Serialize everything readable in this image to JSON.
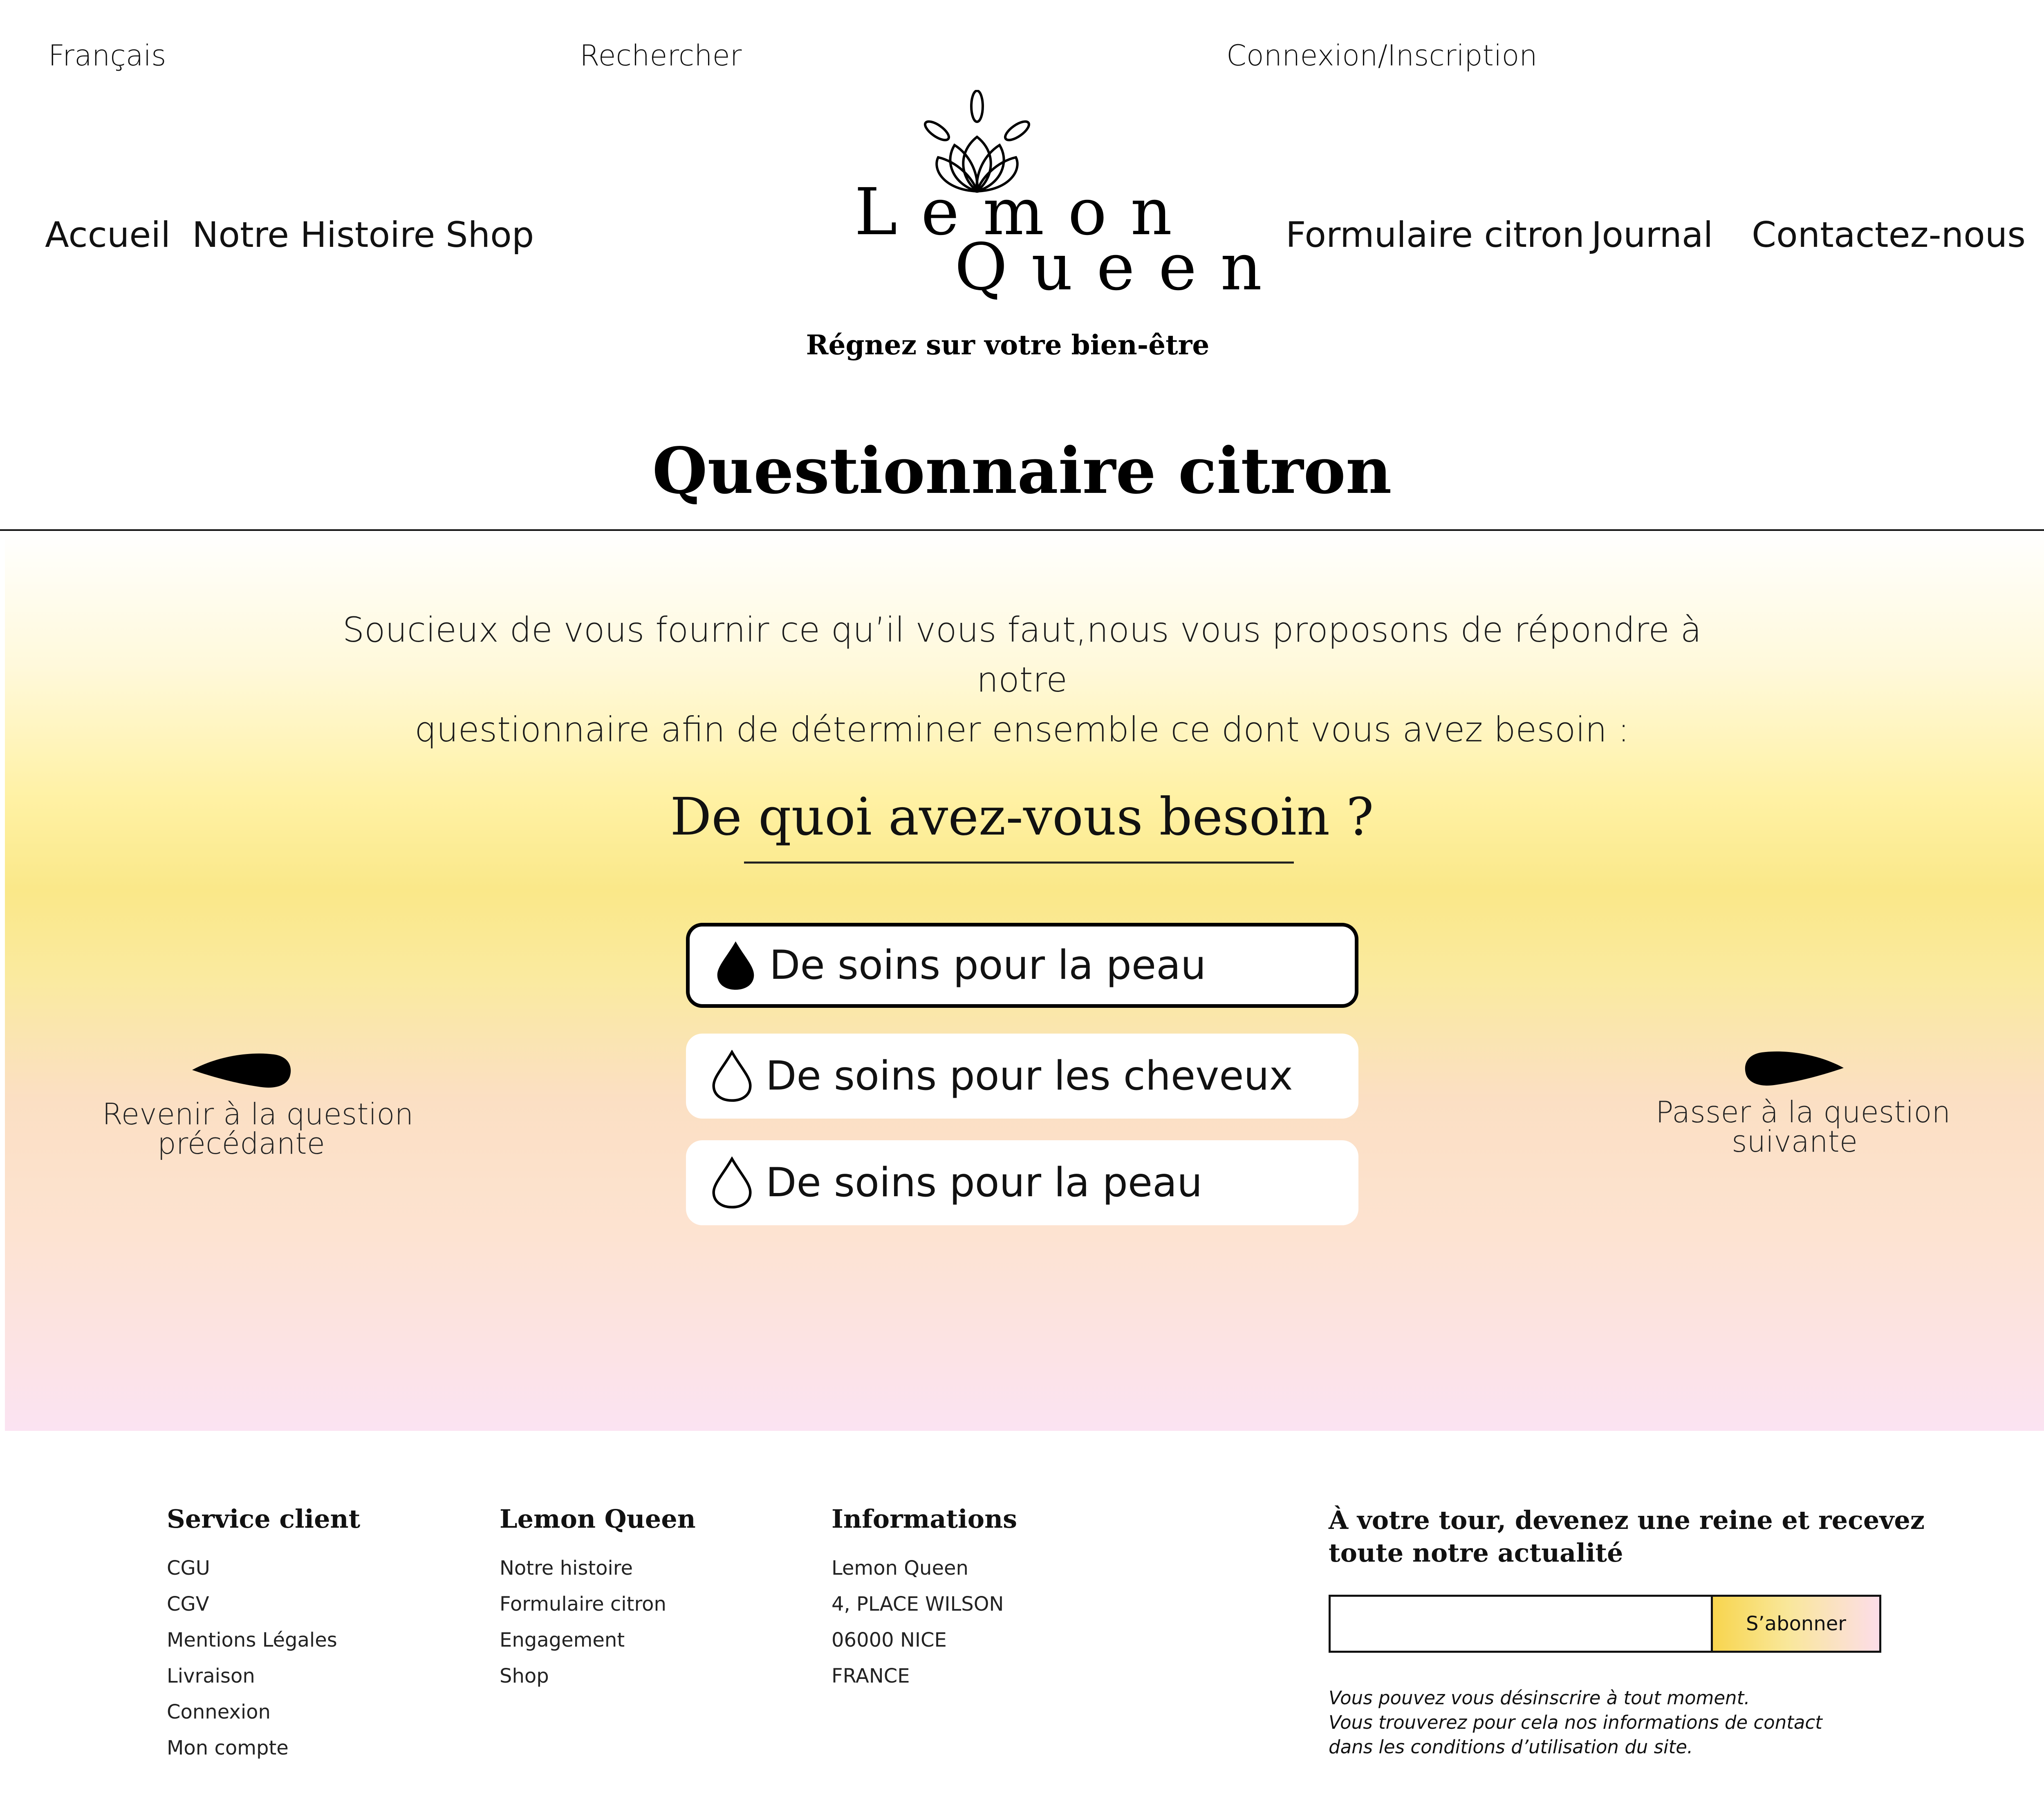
{
  "header": {
    "language": "Français",
    "search": "Rechercher",
    "account": "Connexion/Inscription",
    "nav_left": [
      "Accueil",
      "Notre Histoire",
      "Shop"
    ],
    "nav_right": [
      "Formulaire citron",
      "Journal",
      "Contactez-nous"
    ],
    "logo": {
      "line1": "Lemon",
      "line2": "Queen",
      "tagline": "Régnez sur votre bien-être"
    }
  },
  "page": {
    "title": "Questionnaire citron",
    "intro_line1": "Soucieux de vous fournir ce qu’il vous faut,nous vous proposons de répondre à notre",
    "intro_line2": "questionnaire afin de déterminer ensemble ce dont vous avez besoin :",
    "question": "De quoi avez-vous besoin ?",
    "options": [
      {
        "label": "De soins pour la peau",
        "selected": true
      },
      {
        "label": "De soins pour les cheveux",
        "selected": false
      },
      {
        "label": "De soins pour la peau",
        "selected": false
      }
    ],
    "prev_line1": "Revenir à la question",
    "prev_line2": "précédante",
    "next_line1": "Passer à la question",
    "next_line2": "suivante"
  },
  "footer": {
    "service": {
      "title": "Service client",
      "links": [
        "CGU",
        "CGV",
        "Mentions Légales",
        "Livraison",
        "Connexion",
        "Mon compte"
      ]
    },
    "brand": {
      "title": "Lemon Queen",
      "links": [
        "Notre histoire",
        "Formulaire citron",
        "Engagement",
        "Shop"
      ]
    },
    "info": {
      "title": "Informations",
      "lines": [
        "Lemon Queen",
        "4, PLACE WILSON",
        "06000 NICE",
        "FRANCE"
      ]
    },
    "newsletter": {
      "title_line1": "À votre tour, devenez une reine et recevez",
      "title_line2": "toute notre actualité",
      "input_value": "",
      "button": "S’abonner",
      "note_line1": "Vous pouvez vous désinscrire à tout moment.",
      "note_line2": "Vous trouverez pour cela nos informations de contact",
      "note_line3": "dans les conditions d’utilisation du site."
    }
  },
  "colors": {
    "accent_yellow": "#fae889",
    "accent_pink": "#fbe3f2"
  }
}
